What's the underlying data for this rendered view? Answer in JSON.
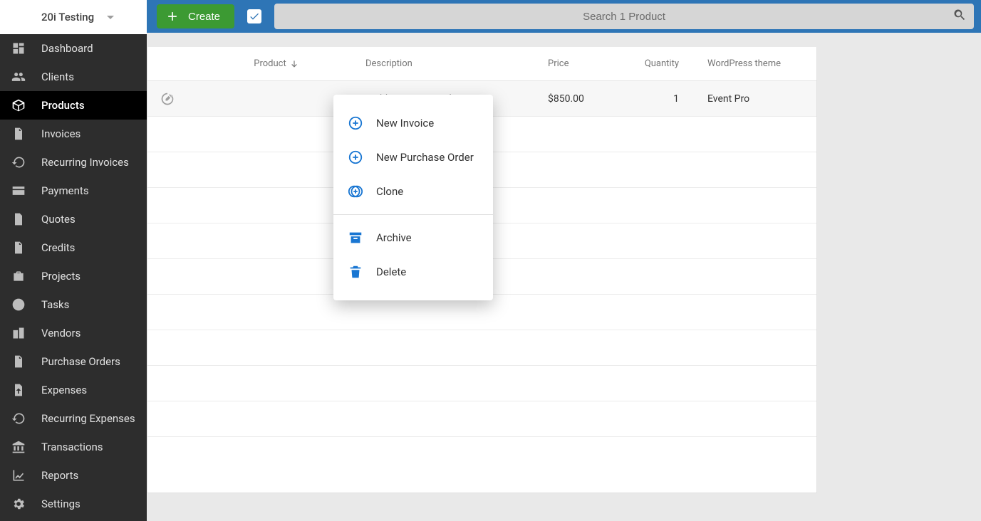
{
  "org": {
    "name": "20i Testing"
  },
  "sidebar": {
    "items": [
      {
        "key": "dashboard",
        "label": "Dashboard",
        "active": false
      },
      {
        "key": "clients",
        "label": "Clients",
        "active": false
      },
      {
        "key": "products",
        "label": "Products",
        "active": true
      },
      {
        "key": "invoices",
        "label": "Invoices",
        "active": false
      },
      {
        "key": "recurring-invoices",
        "label": "Recurring Invoices",
        "active": false
      },
      {
        "key": "payments",
        "label": "Payments",
        "active": false
      },
      {
        "key": "quotes",
        "label": "Quotes",
        "active": false
      },
      {
        "key": "credits",
        "label": "Credits",
        "active": false
      },
      {
        "key": "projects",
        "label": "Projects",
        "active": false
      },
      {
        "key": "tasks",
        "label": "Tasks",
        "active": false
      },
      {
        "key": "vendors",
        "label": "Vendors",
        "active": false
      },
      {
        "key": "purchase-orders",
        "label": "Purchase Orders",
        "active": false
      },
      {
        "key": "expenses",
        "label": "Expenses",
        "active": false
      },
      {
        "key": "recurring-expenses",
        "label": "Recurring Expenses",
        "active": false
      },
      {
        "key": "transactions",
        "label": "Transactions",
        "active": false
      },
      {
        "key": "reports",
        "label": "Reports",
        "active": false
      },
      {
        "key": "settings",
        "label": "Settings",
        "active": false
      }
    ]
  },
  "toolbar": {
    "create_label": "Create",
    "search_placeholder": "Search 1 Product",
    "select_all_checked": true
  },
  "table": {
    "columns": {
      "product": "Product",
      "description": "Description",
      "price": "Price",
      "quantity": "Quantity",
      "theme": "WordPress theme"
    },
    "sort": {
      "column": "product",
      "direction": "desc"
    },
    "rows": [
      {
        "product": "",
        "description": "Build a new WP website",
        "price": "$850.00",
        "quantity": "1",
        "theme": "Event Pro"
      }
    ],
    "blank_rows": 9
  },
  "context_menu": {
    "items": [
      {
        "key": "new-invoice",
        "label": "New Invoice",
        "icon": "plus-circle"
      },
      {
        "key": "new-purchase-order",
        "label": "New Purchase Order",
        "icon": "plus-circle"
      },
      {
        "key": "clone",
        "label": "Clone",
        "icon": "clone"
      },
      {
        "sep": true
      },
      {
        "key": "archive",
        "label": "Archive",
        "icon": "archive"
      },
      {
        "key": "delete",
        "label": "Delete",
        "icon": "trash"
      }
    ]
  }
}
